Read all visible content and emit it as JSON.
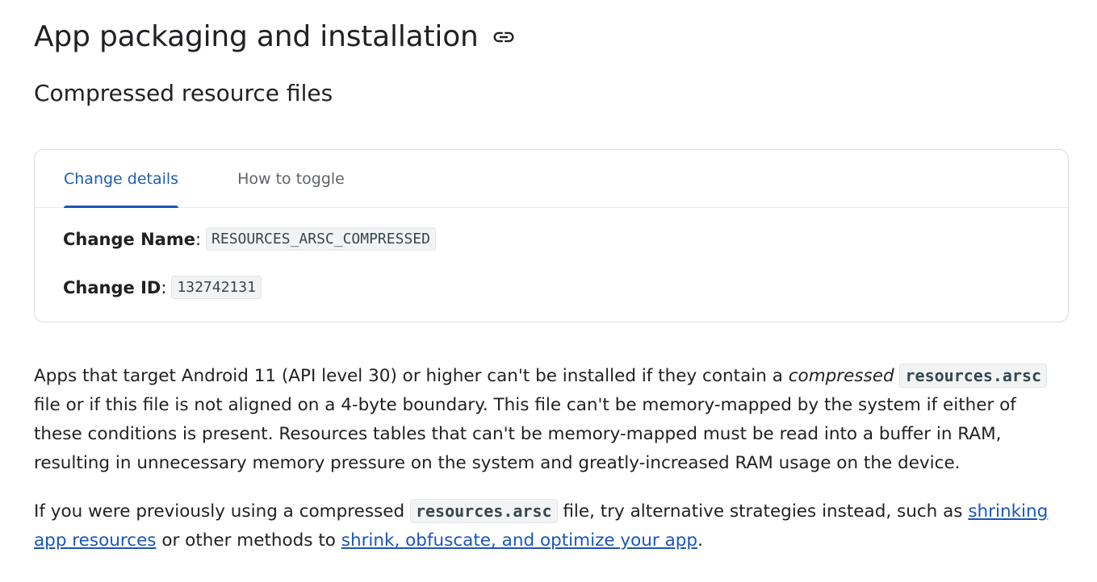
{
  "page": {
    "title": "App packaging and installation",
    "subtitle": "Compressed resource files"
  },
  "card": {
    "tabs": [
      {
        "label": "Change details",
        "active": true
      },
      {
        "label": "How to toggle",
        "active": false
      }
    ],
    "change_name_label": "Change Name",
    "change_name_value": "RESOURCES_ARSC_COMPRESSED",
    "change_id_label": "Change ID",
    "change_id_value": "132742131"
  },
  "paragraph1": {
    "part1": "Apps that target Android 11 (API level 30) or higher can't be installed if they contain a ",
    "emphasis": "compressed",
    "code": "resources.arsc",
    "part2": " file or if this file is not aligned on a 4-byte boundary. This file can't be memory-mapped by the system if either of these conditions is present. Resources tables that can't be memory-mapped must be read into a buffer in RAM, resulting in unnecessary memory pressure on the system and greatly-increased RAM usage on the device."
  },
  "paragraph2": {
    "part1": "If you were previously using a compressed ",
    "code": "resources.arsc",
    "part2": " file, try alternative strategies instead, such as ",
    "link1": "shrinking app resources",
    "part3": " or other methods to ",
    "link2": "shrink, obfuscate, and optimize your app",
    "part4": "."
  },
  "colors": {
    "accent": "#1a56b7",
    "text": "#202124",
    "border": "#dadce0"
  },
  "icons": {
    "heading_link": "link-icon"
  }
}
